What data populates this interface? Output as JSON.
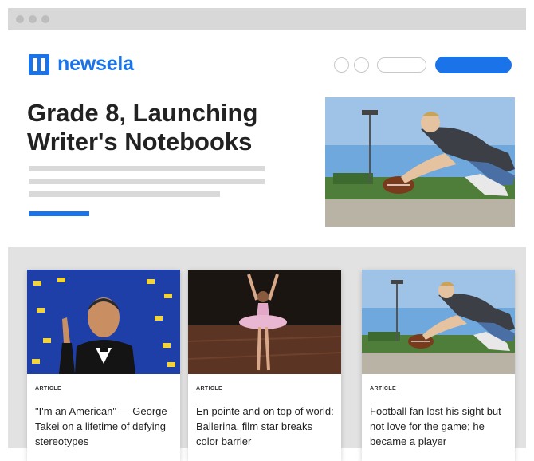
{
  "brand": {
    "name": "newsela",
    "color": "#1a73e8",
    "icon": "newsela-logo-icon"
  },
  "hero": {
    "title": "Grade 8, Launching Writer's Notebooks",
    "image": "football-kicker-photo"
  },
  "cards": [
    {
      "tag": "ARTICLE",
      "title": "\"I'm an American\" — George Takei on a lifetime of defying stereotypes",
      "image": "george-takei-photo"
    },
    {
      "tag": "ARTICLE",
      "title": "En pointe and on top of world: Ballerina, film star breaks color barrier",
      "image": "ballerina-photo"
    },
    {
      "tag": "ARTICLE",
      "title": "Football fan lost his sight but not love for the game; he became a player",
      "image": "football-kicker-photo"
    }
  ]
}
